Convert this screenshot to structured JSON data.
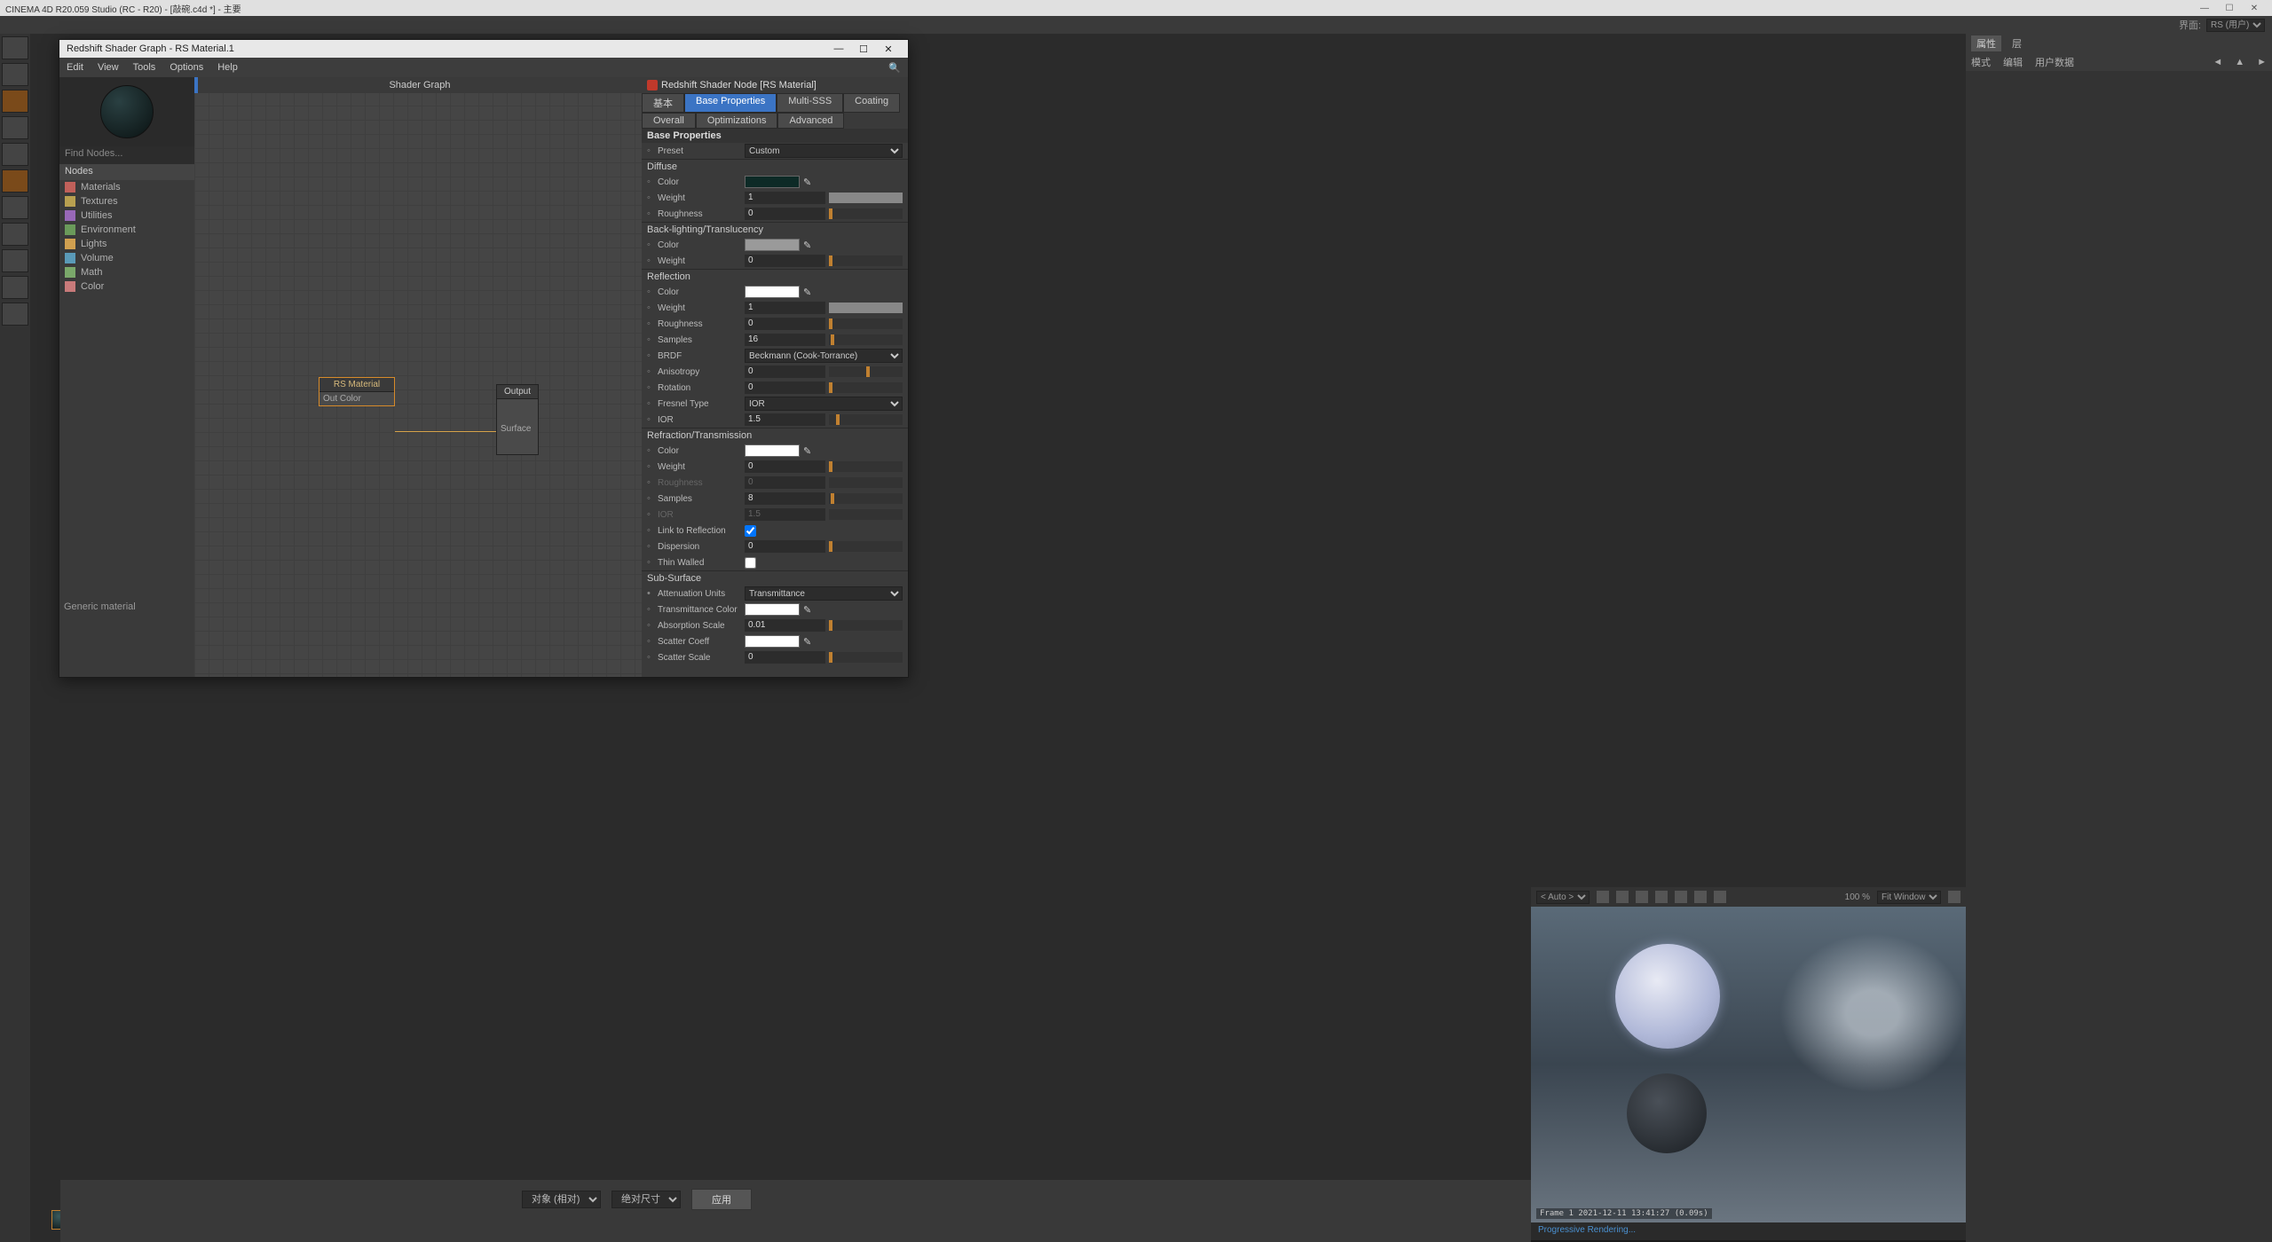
{
  "app_title": "CINEMA 4D R20.059 Studio (RC - R20) - [敲碗.c4d *] - 主要",
  "layout_label": "界面:",
  "layout_value": "RS (用户)",
  "right_panel": {
    "tabs": [
      "属性",
      "层"
    ],
    "sub": [
      "模式",
      "编辑",
      "用户数据"
    ]
  },
  "shader_window": {
    "title": "Redshift Shader Graph - RS Material.1",
    "menu": [
      "Edit",
      "View",
      "Tools",
      "Options",
      "Help"
    ],
    "graph_title": "Shader Graph",
    "find_placeholder": "Find Nodes...",
    "nodes_label": "Nodes",
    "categories": [
      {
        "name": "Materials",
        "color": "#c0605a"
      },
      {
        "name": "Textures",
        "color": "#b8a050"
      },
      {
        "name": "Utilities",
        "color": "#9868b8"
      },
      {
        "name": "Environment",
        "color": "#6a9a5a"
      },
      {
        "name": "Lights",
        "color": "#d0a050"
      },
      {
        "name": "Volume",
        "color": "#5a9ab8"
      },
      {
        "name": "Math",
        "color": "#7aa86a"
      },
      {
        "name": "Color",
        "color": "#c87a7a"
      }
    ],
    "node_mat": {
      "title": "RS Material",
      "port": "Out Color"
    },
    "node_out": {
      "title": "Output",
      "port": "Surface"
    }
  },
  "props": {
    "header": "Redshift Shader Node [RS Material]",
    "tabs_row1": [
      "基本",
      "Base Properties",
      "Multi-SSS"
    ],
    "tabs_row2": [
      "Coating",
      "Overall",
      "Optimizations"
    ],
    "tabs_row3": [
      "Advanced"
    ],
    "active_tab": "Base Properties",
    "section": "Base Properties",
    "preset_label": "Preset",
    "preset_value": "Custom",
    "groups": {
      "diffuse": {
        "title": "Diffuse",
        "color_label": "Color",
        "color": "#0d2a26",
        "weight_label": "Weight",
        "weight": "1",
        "rough_label": "Roughness",
        "rough": "0"
      },
      "backlight": {
        "title": "Back-lighting/Translucency",
        "color_label": "Color",
        "color": "#9a9a9a",
        "weight_label": "Weight",
        "weight": "0"
      },
      "reflection": {
        "title": "Reflection",
        "color_label": "Color",
        "color": "#ffffff",
        "weight_label": "Weight",
        "weight": "1",
        "rough_label": "Roughness",
        "rough": "0",
        "samples_label": "Samples",
        "samples": "16",
        "brdf_label": "BRDF",
        "brdf": "Beckmann (Cook-Torrance)",
        "aniso_label": "Anisotropy",
        "aniso": "0",
        "rot_label": "Rotation",
        "rot": "0",
        "fresnel_label": "Fresnel Type",
        "fresnel": "IOR",
        "ior_label": "IOR",
        "ior": "1.5"
      },
      "refraction": {
        "title": "Refraction/Transmission",
        "color_label": "Color",
        "color": "#ffffff",
        "weight_label": "Weight",
        "weight": "0",
        "rough_label": "Roughness",
        "rough": "0",
        "samples_label": "Samples",
        "samples": "8",
        "ior_label": "IOR",
        "ior": "1.5",
        "link_label": "Link to Reflection",
        "link": true,
        "disp_label": "Dispersion",
        "disp": "0",
        "thin_label": "Thin Walled",
        "thin": false
      },
      "sss": {
        "title": "Sub-Surface",
        "atten_label": "Attenuation Units",
        "atten": "Transmittance",
        "tc_label": "Transmittance Color",
        "tc": "#ffffff",
        "abs_label": "Absorption Scale",
        "abs": "0.01",
        "sc_label": "Scatter Coeff",
        "sc": "#ffffff",
        "ss_label": "Scatter Scale",
        "ss": "0"
      }
    }
  },
  "bottom": {
    "obj": "对象 (相对)",
    "size": "绝对尺寸",
    "apply": "应用"
  },
  "generic_material": "Generic material",
  "render": {
    "auto": "< Auto >",
    "zoom": "100 %",
    "fit": "Fit Window",
    "stat": "Frame 1   2021-12-11  13:41:27  (0.09s)",
    "footer": "Progressive Rendering..."
  }
}
